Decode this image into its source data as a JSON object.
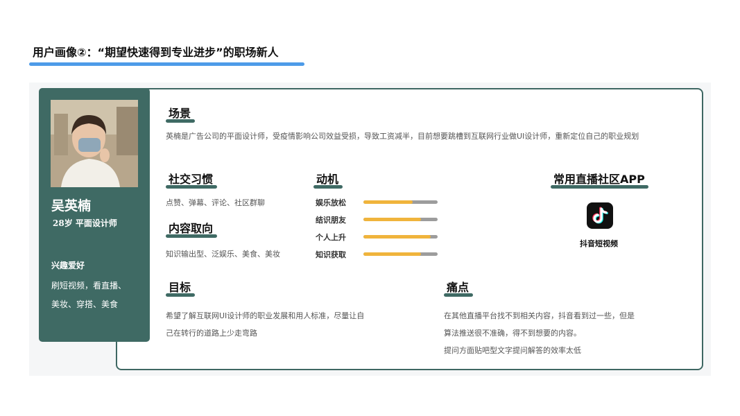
{
  "page": {
    "title": "用户画像②：“期望快速得到专业进步”的职场新人"
  },
  "profile": {
    "name": "吴英楠",
    "subtitle": "28岁   平面设计师",
    "hobby_title": "兴趣爱好",
    "hobby_lines": [
      "刷短视频，看直播、",
      "美妆、穿搭、美食"
    ]
  },
  "scene": {
    "title": "场景",
    "text": "英楠是广告公司的平面设计师，受疫情影响公司效益受损，导致工资减半，目前想要跳槽到互联网行业做UI设计师，重新定位自己的职业规划"
  },
  "social": {
    "title": "社交习惯",
    "text": "点赞、弹幕、评论、社区群聊"
  },
  "content": {
    "title": "内容取向",
    "text": "知识输出型、泛娱乐、美食、美妆"
  },
  "motive": {
    "title": "动机",
    "items": [
      {
        "label": "娱乐放松",
        "value": 0.66
      },
      {
        "label": "结识朋友",
        "value": 0.78
      },
      {
        "label": "个人上升",
        "value": 0.91
      },
      {
        "label": "知识获取",
        "value": 0.78
      }
    ]
  },
  "apps": {
    "title": "常用直播社区APP",
    "app_label": "抖音短视频",
    "app_icon": "tiktok-icon"
  },
  "goal": {
    "title": "目标",
    "lines": [
      "希望了解互联网UI设计师的职业发展和用人标准，尽量让自",
      "己在转行的道路上少走弯路"
    ]
  },
  "pain": {
    "title": "痛点",
    "lines": [
      "在其他直播平台找不到相关内容，抖音看到过一些，但是",
      "算法推送很不准确，得不到想要的内容。",
      "提问方面贴吧型文字提问解答的效率太低"
    ]
  },
  "colors": {
    "accent_blue": "#4d9be8",
    "teal": "#3f6a64",
    "bar_fill": "#f0b43c",
    "bar_track": "#9c9c9c"
  }
}
